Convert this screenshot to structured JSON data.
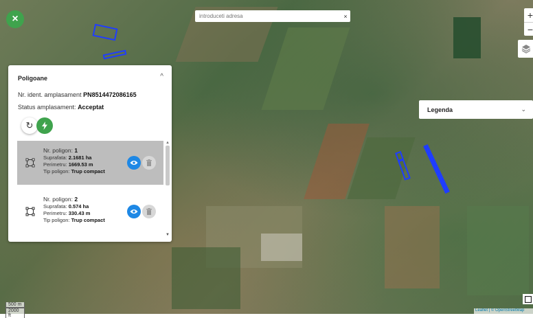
{
  "search": {
    "placeholder": "introduceti adresa",
    "clear_glyph": "×"
  },
  "close_button": {
    "glyph": "×"
  },
  "zoom": {
    "in": "+",
    "out": "−"
  },
  "legend": {
    "title": "Legenda",
    "chevron": "⌄"
  },
  "panel": {
    "title": "Poligoane",
    "collapse_glyph": "^",
    "ident_label": "Nr. ident. amplasament",
    "ident_value": "PN8514472086165",
    "status_label": "Status amplasament:",
    "status_value": "Acceptat",
    "refresh_glyph": "↻"
  },
  "polygons": [
    {
      "nr_label": "Nr. poligon:",
      "nr": "1",
      "area_label": "Suprafata:",
      "area": "2.1681 ha",
      "perim_label": "Perimetru:",
      "perim": "1669.53 m",
      "type_label": "Tip poligon:",
      "type": "Trup compact",
      "selected": true
    },
    {
      "nr_label": "Nr. poligon:",
      "nr": "2",
      "area_label": "Suprafata:",
      "area": "0.574 ha",
      "perim_label": "Perimetru:",
      "perim": "330.43 m",
      "type_label": "Tip poligon:",
      "type": "Trup compact",
      "selected": false
    }
  ],
  "scale": {
    "metric": "500 m",
    "imperial": "2000 ft"
  },
  "attribution": "Leaflet | © OpenStreetMap",
  "colors": {
    "accent_green": "#3fa34d",
    "eye_blue": "#1e88e5",
    "polygon_outline": "#1f3dff"
  }
}
